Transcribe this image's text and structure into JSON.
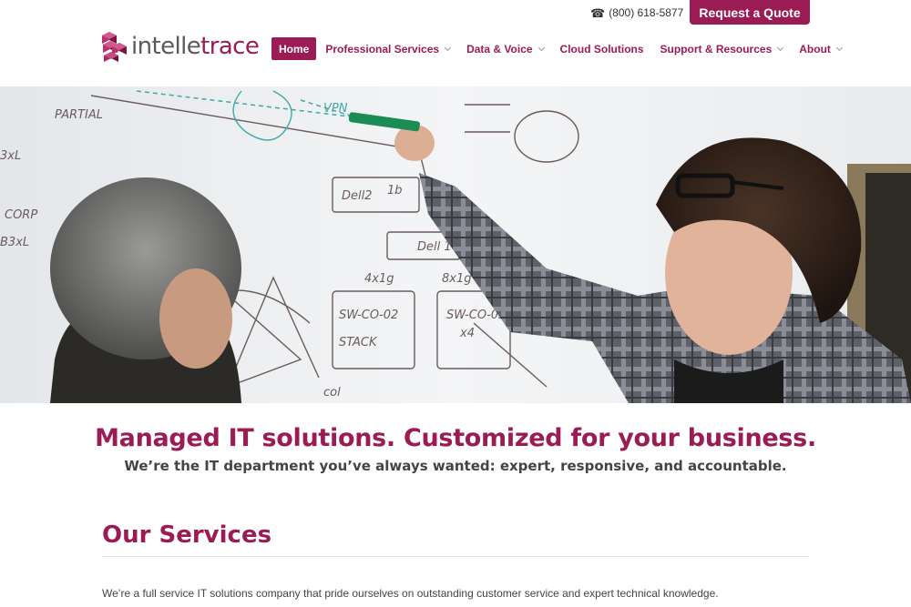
{
  "header": {
    "phone": "(800) 618-5877",
    "phone_icon": "telephone-icon",
    "cta_label": "Request a Quote",
    "logo": {
      "part1": "intelle",
      "part2": "trace",
      "icon": "cube-stack-logo-icon"
    }
  },
  "nav": {
    "items": [
      {
        "label": "Home",
        "active": true,
        "dropdown": false
      },
      {
        "label": "Professional Services",
        "active": false,
        "dropdown": true
      },
      {
        "label": "Data & Voice",
        "active": false,
        "dropdown": true
      },
      {
        "label": "Cloud Solutions",
        "active": false,
        "dropdown": false
      },
      {
        "label": "Support & Resources",
        "active": false,
        "dropdown": true
      },
      {
        "label": "About",
        "active": false,
        "dropdown": true
      }
    ]
  },
  "hero": {
    "image": "two-men-at-whiteboard-network-diagram",
    "whiteboard_text": [
      "VPN",
      "Dell2",
      "1b",
      "Dell 10",
      "SW-CO-02",
      "SW-CO-03",
      "4x1g",
      "8x1g",
      "STACK",
      "x4",
      "col",
      "PARTIAL",
      "3xL",
      "CORP",
      "B3xL"
    ]
  },
  "main": {
    "headline": "Managed IT solutions. Customized for your business.",
    "subheadline": "We’re the IT department you’ve always wanted: expert, responsive, and accountable.",
    "services_title": "Our Services",
    "services_intro": "We’re a full service IT solutions company that pride ourselves on outstanding customer service and expert technical knowledge."
  },
  "colors": {
    "brand": "#9b1c55",
    "text": "#444444",
    "divider": "#e2e2e2"
  }
}
